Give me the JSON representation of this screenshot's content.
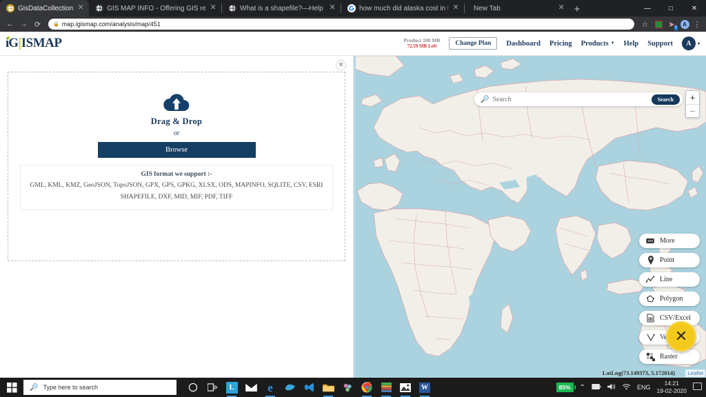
{
  "browser": {
    "tabs": [
      {
        "title": "GisDataCollection",
        "favicon": "globe-tan-icon",
        "active": true
      },
      {
        "title": "GIS MAP INFO - Offering GIS rel",
        "favicon": "globe-dark-icon",
        "active": false
      },
      {
        "title": "What is a shapefile?—Help | Arc",
        "favicon": "globe-dark-icon",
        "active": false
      },
      {
        "title": "how much did alaska cost in tod",
        "favicon": "google-icon",
        "active": false
      },
      {
        "title": "New Tab",
        "favicon": "blank-icon",
        "active": false
      }
    ],
    "new_tab_label": "+",
    "window_controls": {
      "minimize": "—",
      "maximize": "□",
      "close": "✕"
    },
    "toolbar": {
      "back": "←",
      "forward": "→",
      "reload": "⟳",
      "url": "map.igismap.com/analysis/map/451",
      "lock_icon": "lock-icon",
      "star_icon": "star-icon",
      "profile_initial": "A",
      "extension_badge": "1",
      "menu_icon": "kebab-menu-icon"
    }
  },
  "site": {
    "logo": {
      "prefix": "i",
      "bar": "|",
      "rest_a": "G",
      "rest_b": "ISMAP",
      "full": "iGISMAP"
    },
    "quota": {
      "plan": "Product 100 MB",
      "left": "72.59 MB Left"
    },
    "change_plan_label": "Change Plan",
    "nav": [
      {
        "label": "Dashboard",
        "has_caret": false
      },
      {
        "label": "Pricing",
        "has_caret": false
      },
      {
        "label": "Products",
        "has_caret": true
      },
      {
        "label": "Help",
        "has_caret": false
      },
      {
        "label": "Support",
        "has_caret": false
      }
    ],
    "account_initial": "A",
    "account_caret": "▾"
  },
  "upload": {
    "close_label": "✕",
    "cloud_icon": "cloud-upload-icon",
    "title": "Drag & Drop",
    "or": "or",
    "browse_label": "Browse",
    "formats_heading": "GIS format we support :-",
    "formats_line1": "GML, KML, KMZ, GeoJSON, TopoJSON, GPX, GPS, GPKG, XLSX, ODS, MAPINFO, SQLITE, CSV, ESRI",
    "formats_line2": "SHAPEFILE, DXF, MID, MIF, PDF, TIFF"
  },
  "map": {
    "search_placeholder": "Search",
    "search_value": "",
    "search_button_label": "Search",
    "zoom_in_label": "+",
    "zoom_out_label": "−",
    "tools": [
      {
        "label": "More",
        "icon": "more-dots-icon"
      },
      {
        "label": "Point",
        "icon": "map-pin-icon"
      },
      {
        "label": "Line",
        "icon": "polyline-icon"
      },
      {
        "label": "Polygon",
        "icon": "polygon-icon"
      },
      {
        "label": "CSV/Excel",
        "icon": "spreadsheet-file-icon"
      },
      {
        "label": "Vector",
        "icon": "vector-icon"
      },
      {
        "label": "Raster",
        "icon": "raster-grid-icon"
      }
    ],
    "fab_label": "✕",
    "fab_icon": "close-x-icon",
    "coordinates": "LatLng(73.149373, 5.172014)",
    "attribution": "Leaflet",
    "colors": {
      "ocean": "#aad3df",
      "land": "#f2efe9",
      "border": "#d9a3ad"
    }
  },
  "taskbar": {
    "start_icon": "windows-start-icon",
    "search_placeholder": "Type here to search",
    "icons": [
      {
        "name": "cortana-icon",
        "glyph": "○"
      },
      {
        "name": "task-view-icon",
        "glyph": "☰"
      },
      {
        "name": "app-l-icon",
        "glyph": "L"
      },
      {
        "name": "mail-icon",
        "glyph": "✉"
      },
      {
        "name": "edge-icon",
        "glyph": "e"
      },
      {
        "name": "skype-icon",
        "glyph": "S"
      },
      {
        "name": "vscode-icon",
        "glyph": "⯈"
      },
      {
        "name": "file-explorer-icon",
        "glyph": "🗀"
      },
      {
        "name": "paint-icon",
        "glyph": "✿"
      },
      {
        "name": "chrome-icon",
        "glyph": "◉"
      },
      {
        "name": "qgis-icon",
        "glyph": "▦"
      },
      {
        "name": "photos-icon",
        "glyph": "⛰"
      },
      {
        "name": "word-icon",
        "glyph": "W"
      }
    ],
    "battery_percent": "85%",
    "tray_chevron": "⌃",
    "tray_battery_icon": "battery-icon",
    "tray_volume_icon": "volume-icon",
    "tray_wifi_icon": "wifi-icon",
    "language": "ENG",
    "time": "14:21",
    "date": "19-02-2020",
    "notification_icon": "notification-icon"
  }
}
